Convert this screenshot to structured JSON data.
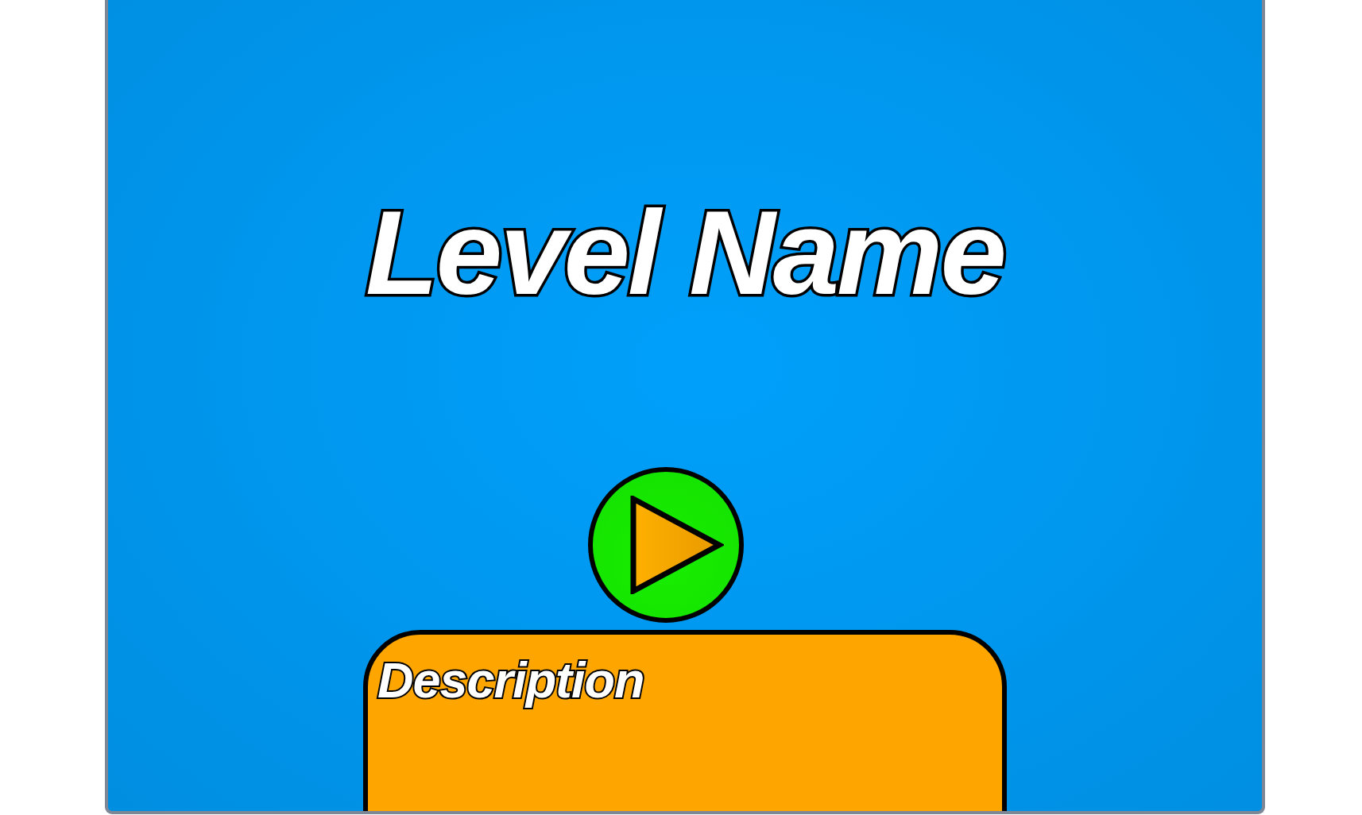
{
  "level": {
    "title": "Level Name",
    "description": {
      "label": "Description"
    }
  }
}
